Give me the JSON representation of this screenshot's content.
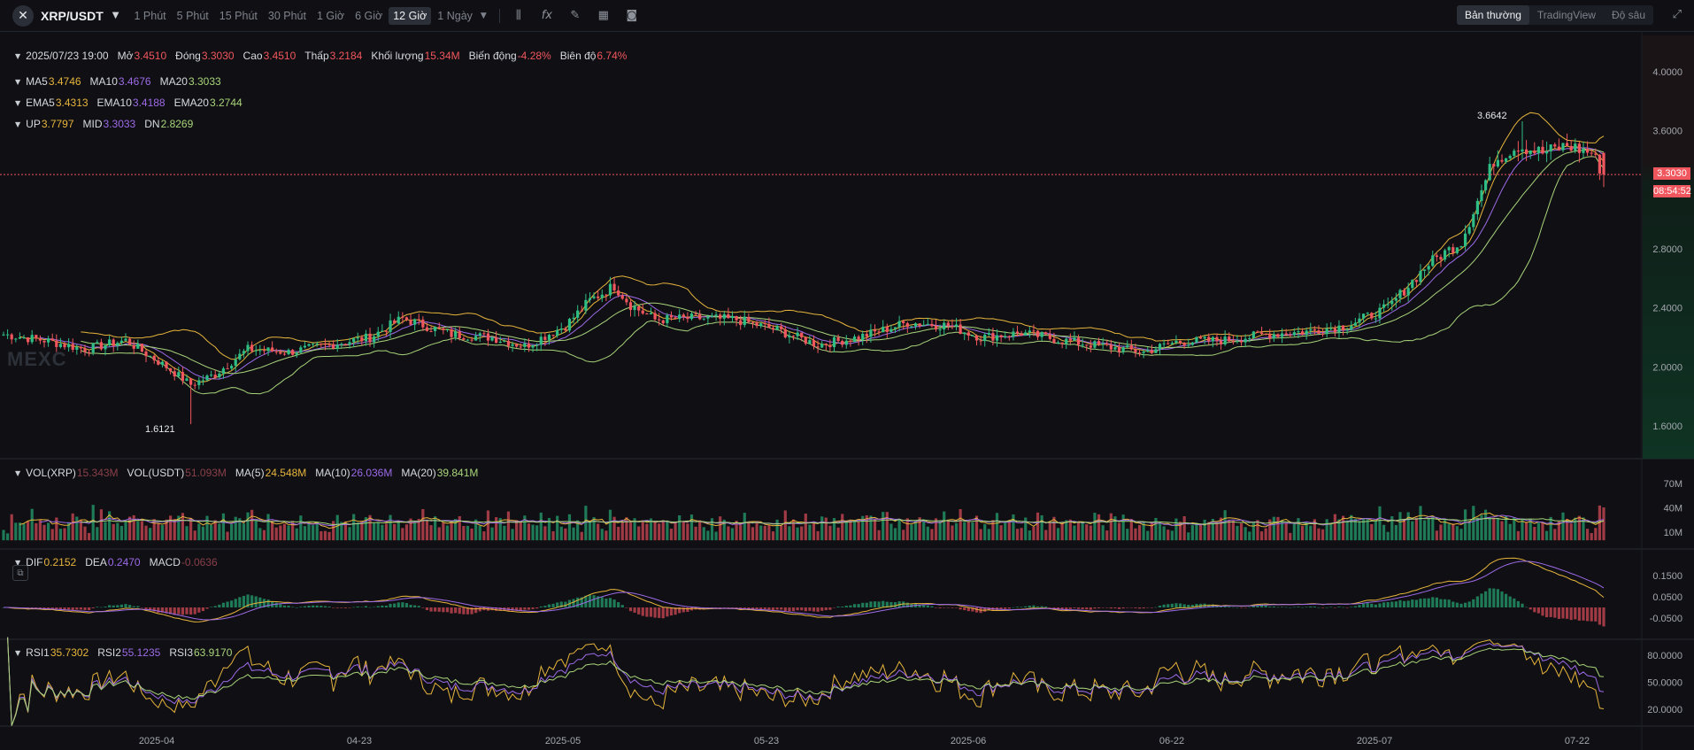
{
  "header": {
    "pair": "XRP/USDT",
    "intervals": [
      "1 Phút",
      "5 Phút",
      "15 Phút",
      "30 Phút",
      "1 Giờ",
      "6 Giờ",
      "12 Giờ",
      "1 Ngày"
    ],
    "active_interval": "12 Giờ",
    "tools": [
      "candle-type-icon",
      "formula-icon",
      "draw-icon",
      "layout-icon",
      "camera-icon"
    ],
    "view_tabs": [
      "Bản thường",
      "TradingView",
      "Độ sâu"
    ],
    "active_view": "Bản thường"
  },
  "ohlc": {
    "date": "2025/07/23 19:00",
    "open_label": "Mở",
    "open": "3.4510",
    "close_label": "Đóng",
    "close": "3.3030",
    "high_label": "Cao",
    "high": "3.4510",
    "low_label": "Thấp",
    "low": "3.2184",
    "volume_label": "Khối lượng",
    "volume": "15.34M",
    "change_label": "Biến động",
    "change": "-4.28%",
    "amplitude_label": "Biên độ",
    "amplitude": "6.74%"
  },
  "ma": {
    "ma5_label": "MA5",
    "ma5": "3.4746",
    "ma10_label": "MA10",
    "ma10": "3.4676",
    "ma20_label": "MA20",
    "ma20": "3.3033"
  },
  "ema": {
    "ema5_label": "EMA5",
    "ema5": "3.4313",
    "ema10_label": "EMA10",
    "ema10": "3.4188",
    "ema20_label": "EMA20",
    "ema20": "3.2744"
  },
  "boll": {
    "up_label": "UP",
    "up": "3.7797",
    "mid_label": "MID",
    "mid": "3.3033",
    "dn_label": "DN",
    "dn": "2.8269"
  },
  "vol": {
    "xrp_label": "VOL(XRP)",
    "xrp": "15.343M",
    "usdt_label": "VOL(USDT)",
    "usdt": "51.093M",
    "ma5_label": "MA(5)",
    "ma5": "24.548M",
    "ma10_label": "MA(10)",
    "ma10": "26.036M",
    "ma20_label": "MA(20)",
    "ma20": "39.841M"
  },
  "macd": {
    "dif_label": "DIF",
    "dif": "0.2152",
    "dea_label": "DEA",
    "dea": "0.2470",
    "macd_label": "MACD",
    "macd": "-0.0636"
  },
  "rsi": {
    "rsi1_label": "RSI1",
    "rsi1": "35.7302",
    "rsi2_label": "RSI2",
    "rsi2": "55.1235",
    "rsi3_label": "RSI3",
    "rsi3": "63.9170"
  },
  "current_price": "3.3030",
  "countdown": "08:54:52",
  "max_marker": "3.6642",
  "min_marker": "1.6121",
  "watermark": "MEXC",
  "colors": {
    "up": "#2ebd85",
    "down": "#f0565d",
    "ma5": "#e6b43c",
    "ma10": "#9c6ae8",
    "ma20": "#a8d47a",
    "boll_up": "#e6b43c",
    "boll_dn": "#a8d47a"
  },
  "chart_data": {
    "type": "candlestick",
    "price_axis": {
      "ticks": [
        4.0,
        3.6,
        2.8,
        2.4,
        2.0,
        1.6
      ],
      "tick_labels": [
        "4.0000",
        "3.6000",
        "2.8000",
        "2.4000",
        "2.0000",
        "1.6000"
      ]
    },
    "volume_axis": {
      "ticks": [
        70,
        40,
        10
      ],
      "tick_labels": [
        "70M",
        "40M",
        "10M"
      ]
    },
    "macd_axis": {
      "ticks": [
        0.15,
        0.05,
        -0.05
      ],
      "tick_labels": [
        "0.1500",
        "0.0500",
        "-0.0500"
      ]
    },
    "rsi_axis": {
      "ticks": [
        80,
        50,
        20
      ],
      "tick_labels": [
        "80.0000",
        "50.0000",
        "20.0000"
      ]
    },
    "time_axis": {
      "labels": [
        "2025-04",
        "04-23",
        "2025-05",
        "05-23",
        "2025-06",
        "06-22",
        "2025-07",
        "07-22"
      ]
    },
    "price_anchors": [
      [
        0,
        2.22
      ],
      [
        10,
        2.18
      ],
      [
        20,
        2.12
      ],
      [
        30,
        2.18
      ],
      [
        40,
        2.0
      ],
      [
        46,
        1.88
      ],
      [
        52,
        1.95
      ],
      [
        60,
        2.12
      ],
      [
        70,
        2.1
      ],
      [
        80,
        2.15
      ],
      [
        90,
        2.2
      ],
      [
        98,
        2.33
      ],
      [
        110,
        2.22
      ],
      [
        120,
        2.2
      ],
      [
        128,
        2.14
      ],
      [
        138,
        2.28
      ],
      [
        144,
        2.45
      ],
      [
        150,
        2.55
      ],
      [
        154,
        2.42
      ],
      [
        160,
        2.32
      ],
      [
        170,
        2.33
      ],
      [
        180,
        2.32
      ],
      [
        190,
        2.25
      ],
      [
        200,
        2.15
      ],
      [
        210,
        2.2
      ],
      [
        222,
        2.3
      ],
      [
        232,
        2.28
      ],
      [
        240,
        2.2
      ],
      [
        250,
        2.23
      ],
      [
        260,
        2.18
      ],
      [
        270,
        2.14
      ],
      [
        280,
        2.1
      ],
      [
        288,
        2.17
      ],
      [
        300,
        2.18
      ],
      [
        310,
        2.22
      ],
      [
        320,
        2.24
      ],
      [
        330,
        2.28
      ],
      [
        340,
        2.4
      ],
      [
        350,
        2.7
      ],
      [
        358,
        2.85
      ],
      [
        366,
        3.4
      ],
      [
        372,
        3.5
      ],
      [
        378,
        3.45
      ],
      [
        384,
        3.5
      ],
      [
        390,
        3.45
      ],
      [
        393,
        3.3
      ]
    ]
  }
}
